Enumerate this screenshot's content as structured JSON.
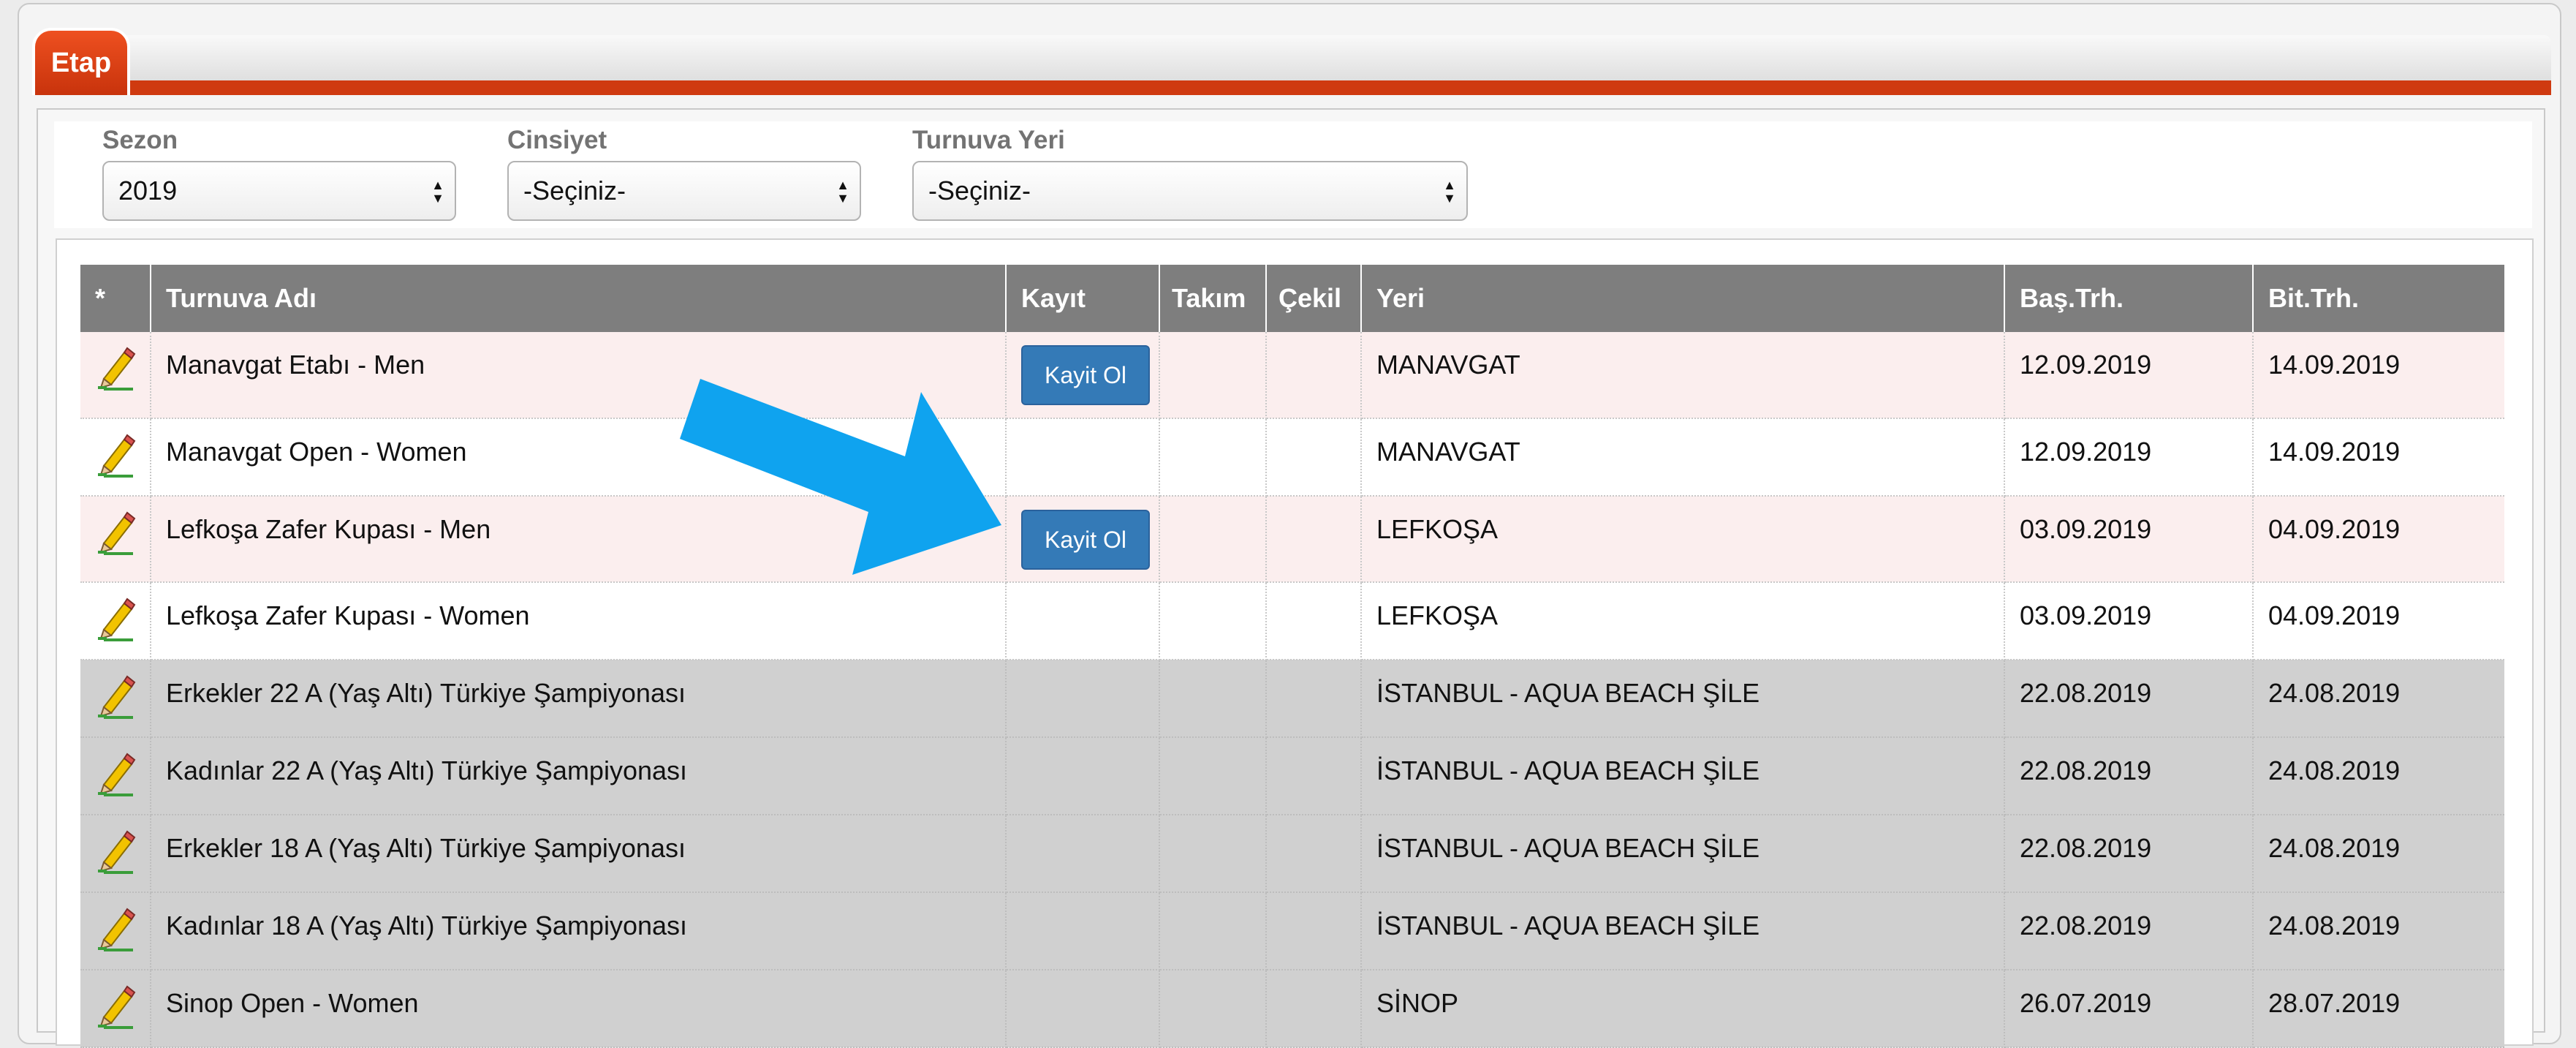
{
  "tab": {
    "label": "Etap"
  },
  "filters": {
    "sezon": {
      "label": "Sezon",
      "value": "2019"
    },
    "cinsiyet": {
      "label": "Cinsiyet",
      "value": "-Seçiniz-"
    },
    "turnuva_yeri": {
      "label": "Turnuva Yeri",
      "value": "-Seçiniz-"
    }
  },
  "table": {
    "columns": [
      "*",
      "Turnuva Adı",
      "Kayıt",
      "Takım",
      "Çekil",
      "Yeri",
      "Baş.Trh.",
      "Bit.Trh."
    ],
    "rows": [
      {
        "name": "Manavgat Etabı - Men",
        "kayit": "Kayit Ol",
        "yeri": "MANAVGAT",
        "bas": "12.09.2019",
        "bit": "14.09.2019"
      },
      {
        "name": "Manavgat Open - Women",
        "kayit": "",
        "yeri": "MANAVGAT",
        "bas": "12.09.2019",
        "bit": "14.09.2019"
      },
      {
        "name": "Lefkoşa Zafer Kupası - Men",
        "kayit": "Kayit Ol",
        "yeri": "LEFKOŞA",
        "bas": "03.09.2019",
        "bit": "04.09.2019"
      },
      {
        "name": "Lefkoşa Zafer Kupası - Women",
        "kayit": "",
        "yeri": "LEFKOŞA",
        "bas": "03.09.2019",
        "bit": "04.09.2019"
      },
      {
        "name": "Erkekler 22 A (Yaş Altı) Türkiye Şampiyonası",
        "kayit": "",
        "yeri": "İSTANBUL - AQUA BEACH ŞİLE",
        "bas": "22.08.2019",
        "bit": "24.08.2019"
      },
      {
        "name": "Kadınlar 22 A (Yaş Altı) Türkiye Şampiyonası",
        "kayit": "",
        "yeri": "İSTANBUL - AQUA BEACH ŞİLE",
        "bas": "22.08.2019",
        "bit": "24.08.2019"
      },
      {
        "name": "Erkekler 18 A (Yaş Altı) Türkiye Şampiyonası",
        "kayit": "",
        "yeri": "İSTANBUL - AQUA BEACH ŞİLE",
        "bas": "22.08.2019",
        "bit": "24.08.2019"
      },
      {
        "name": "Kadınlar 18 A (Yaş Altı) Türkiye Şampiyonası",
        "kayit": "",
        "yeri": "İSTANBUL - AQUA BEACH ŞİLE",
        "bas": "22.08.2019",
        "bit": "24.08.2019"
      },
      {
        "name": "Sinop Open - Women",
        "kayit": "",
        "yeri": "SİNOP",
        "bas": "26.07.2019",
        "bit": "28.07.2019"
      }
    ]
  },
  "colors": {
    "accent": "#cf3a10",
    "button": "#347ab7",
    "arrow": "#0fa3ef"
  },
  "icons": {
    "row_action": "edit-pencil-icon"
  }
}
